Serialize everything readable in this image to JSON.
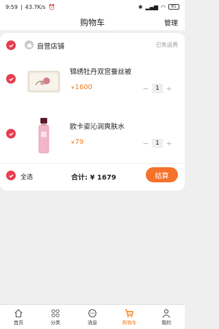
{
  "status_bar": {
    "time": "9:59",
    "speed": "43.7K/s",
    "battery": "81"
  },
  "header": {
    "title": "购物车",
    "manage_label": "管理"
  },
  "shop": {
    "name": "自营店铺",
    "shipping": "已免运费"
  },
  "items": [
    {
      "name": "锦绣牡丹双宫蚕丝被",
      "currency": "¥",
      "price": "1600",
      "quantity": "1",
      "minus": "−",
      "plus": "+"
    },
    {
      "name": "欧卡姿沁润爽肤水",
      "currency": "¥",
      "price": "79",
      "quantity": "1",
      "minus": "−",
      "plus": "+"
    }
  ],
  "footer": {
    "select_all_label": "全选",
    "total_label": "合计: ¥ 1679",
    "checkout_label": "结算"
  },
  "tabs": [
    {
      "label": "首页",
      "icon": "home-icon"
    },
    {
      "label": "分类",
      "icon": "category-icon"
    },
    {
      "label": "消息",
      "icon": "message-icon"
    },
    {
      "label": "购物车",
      "icon": "cart-icon",
      "active": true
    },
    {
      "label": "我的",
      "icon": "user-icon"
    }
  ],
  "colors": {
    "accent": "#f4722b",
    "price": "#f07c1e",
    "check": "#e53e4f"
  }
}
